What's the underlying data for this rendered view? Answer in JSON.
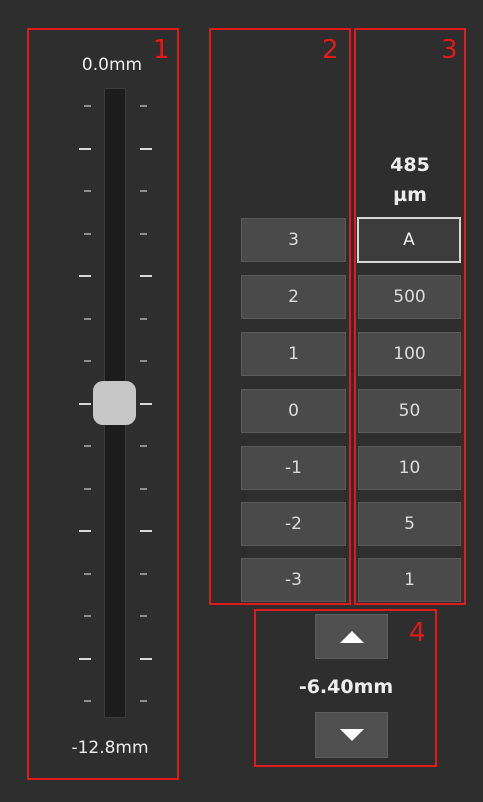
{
  "annotations": {
    "n1": "1",
    "n2": "2",
    "n3": "3",
    "n4": "4"
  },
  "slider": {
    "max_label": "0.0mm",
    "min_label": "-12.8mm",
    "value_mm": -6.4
  },
  "step_resolution": {
    "value": "485",
    "unit": "µm"
  },
  "step_exponent_buttons": [
    "3",
    "2",
    "1",
    "0",
    "-1",
    "-2",
    "-3"
  ],
  "step_size_buttons": [
    "A",
    "500",
    "100",
    "50",
    "10",
    "5",
    "1"
  ],
  "selected_step_size": "A",
  "position": {
    "label": "-6.40mm"
  },
  "colors": {
    "background": "#2e2e2e",
    "annotation": "#e01b1b",
    "button": "#4a4a4a",
    "thumb": "#c6c6c6"
  }
}
